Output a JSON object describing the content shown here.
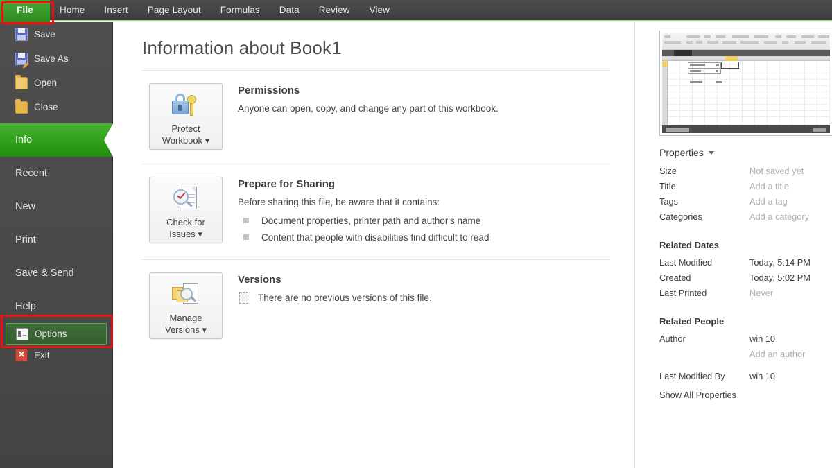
{
  "ribbon": {
    "file_tab": "File",
    "tabs": [
      "Home",
      "Insert",
      "Page Layout",
      "Formulas",
      "Data",
      "Review",
      "View"
    ]
  },
  "sidebar": {
    "commands": [
      {
        "label": "Save",
        "icon": "floppy-disk-icon"
      },
      {
        "label": "Save As",
        "icon": "floppy-disk-pencil-icon"
      },
      {
        "label": "Open",
        "icon": "open-folder-icon"
      },
      {
        "label": "Close",
        "icon": "folder-icon"
      }
    ],
    "nav": [
      {
        "label": "Info",
        "active": true
      },
      {
        "label": "Recent",
        "active": false
      },
      {
        "label": "New",
        "active": false
      },
      {
        "label": "Print",
        "active": false
      },
      {
        "label": "Save & Send",
        "active": false
      },
      {
        "label": "Help",
        "active": false
      }
    ],
    "options": {
      "label": "Options",
      "icon": "options-document-icon"
    },
    "exit": {
      "label": "Exit",
      "icon": "exit-red-x-icon",
      "glyph": "✕"
    }
  },
  "main": {
    "page_title": "Information about Book1",
    "sections": [
      {
        "button_caption_line1": "Protect",
        "button_caption_line2": "Workbook",
        "button_icon": "lock-and-key-icon",
        "title": "Permissions",
        "text": "Anyone can open, copy, and change any part of this workbook.",
        "bullets": []
      },
      {
        "button_caption_line1": "Check for",
        "button_caption_line2": "Issues",
        "button_icon": "document-inspector-icon",
        "title": "Prepare for Sharing",
        "text": "Before sharing this file, be aware that it contains:",
        "bullets": [
          "Document properties, printer path and author's name",
          "Content that people with disabilities find difficult to read"
        ]
      },
      {
        "button_caption_line1": "Manage",
        "button_caption_line2": "Versions",
        "button_icon": "manage-versions-icon",
        "title": "Versions",
        "text": "There are no previous versions of this file.",
        "bullets": []
      }
    ]
  },
  "properties_panel": {
    "thumbnail_name": "workbook-preview-thumbnail",
    "properties_header": "Properties",
    "properties": [
      {
        "key": "Size",
        "value": "Not saved yet",
        "ghost": true
      },
      {
        "key": "Title",
        "value": "Add a title",
        "ghost": true
      },
      {
        "key": "Tags",
        "value": "Add a tag",
        "ghost": true
      },
      {
        "key": "Categories",
        "value": "Add a category",
        "ghost": true
      }
    ],
    "related_dates_header": "Related Dates",
    "related_dates": [
      {
        "key": "Last Modified",
        "value": "Today, 5:14 PM",
        "ghost": false
      },
      {
        "key": "Created",
        "value": "Today, 5:02 PM",
        "ghost": false
      },
      {
        "key": "Last Printed",
        "value": "Never",
        "ghost": true
      }
    ],
    "related_people_header": "Related People",
    "related_people": [
      {
        "key": "Author",
        "value": "win 10",
        "ghost": false
      },
      {
        "key": "",
        "value": "Add an author",
        "ghost": true
      },
      {
        "key": "Last Modified By",
        "value": "win 10",
        "ghost": false
      }
    ],
    "show_all_properties": "Show All Properties"
  },
  "annotations": {
    "file_tab_highlight": "red-rectangle-file-tab",
    "options_highlight": "red-rectangle-options"
  },
  "colors": {
    "accent_green": "#31a21c",
    "file_tab_green": "#3b9e2b",
    "annotation_red": "#ee1111",
    "sidebar_gray": "#4a4a4a",
    "ribbon_gray": "#464646"
  }
}
